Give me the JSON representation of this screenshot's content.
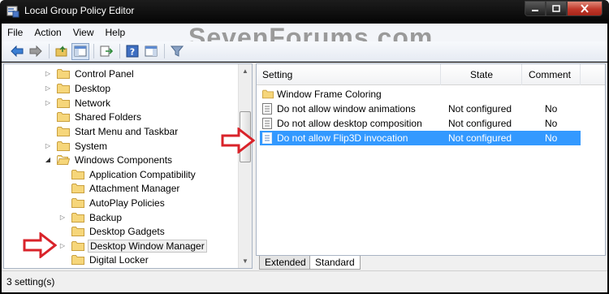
{
  "window": {
    "title": "Local Group Policy Editor",
    "watermark": "SevenForums.com"
  },
  "menu": [
    "File",
    "Action",
    "View",
    "Help"
  ],
  "tree": {
    "items": [
      {
        "label": "Control Panel",
        "expandable": true
      },
      {
        "label": "Desktop",
        "expandable": true
      },
      {
        "label": "Network",
        "expandable": true
      },
      {
        "label": "Shared Folders",
        "expandable": false
      },
      {
        "label": "Start Menu and Taskbar",
        "expandable": false
      },
      {
        "label": "System",
        "expandable": true
      },
      {
        "label": "Windows Components",
        "expandable": true,
        "expanded": true
      },
      {
        "label": "Application Compatibility",
        "expandable": false
      },
      {
        "label": "Attachment Manager",
        "expandable": false
      },
      {
        "label": "AutoPlay Policies",
        "expandable": false
      },
      {
        "label": "Backup",
        "expandable": true
      },
      {
        "label": "Desktop Gadgets",
        "expandable": false
      },
      {
        "label": "Desktop Window Manager",
        "expandable": true,
        "selected": true
      },
      {
        "label": "Digital Locker",
        "expandable": false
      }
    ]
  },
  "list": {
    "columns": [
      "Setting",
      "State",
      "Comment"
    ],
    "rows": [
      {
        "setting": "Window Frame Coloring",
        "state": "",
        "comment": "",
        "type": "folder"
      },
      {
        "setting": "Do not allow window animations",
        "state": "Not configured",
        "comment": "No",
        "type": "policy"
      },
      {
        "setting": "Do not allow desktop composition",
        "state": "Not configured",
        "comment": "No",
        "type": "policy"
      },
      {
        "setting": "Do not allow Flip3D invocation",
        "state": "Not configured",
        "comment": "No",
        "type": "policy",
        "selected": true
      }
    ]
  },
  "tabs": [
    "Extended",
    "Standard"
  ],
  "status": "3 setting(s)",
  "colors": {
    "selection": "#3399ff",
    "annotation_arrow": "#d9232a"
  }
}
